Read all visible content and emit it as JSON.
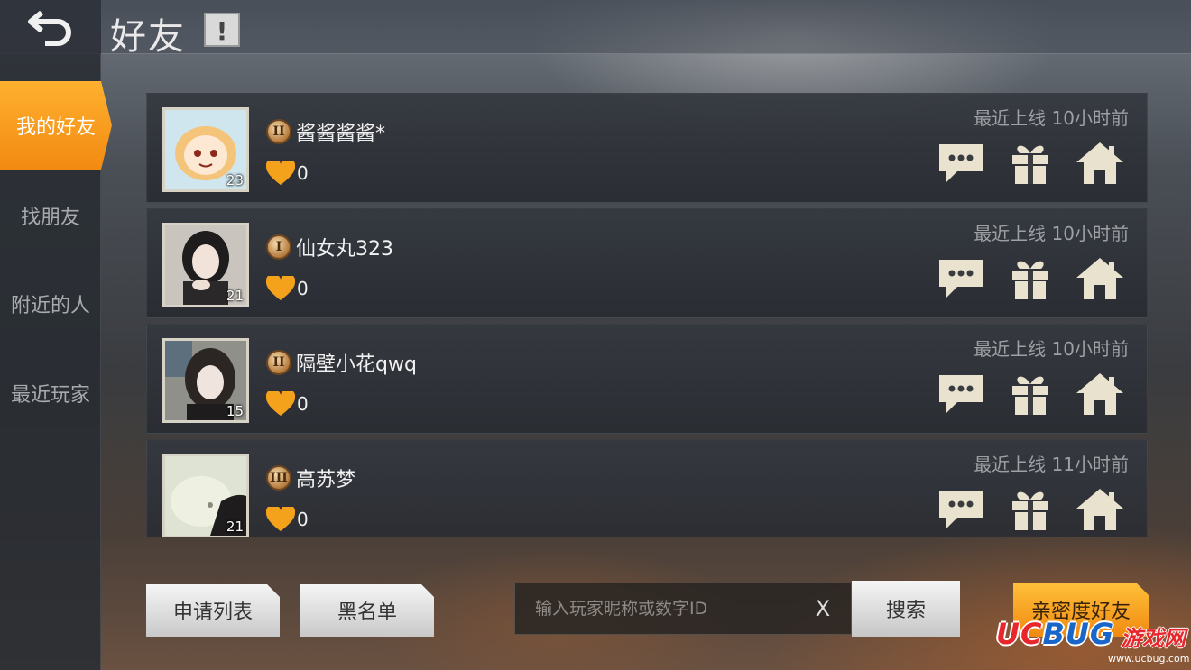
{
  "header": {
    "title": "好友",
    "info_label": "!"
  },
  "sidebar": {
    "items": [
      {
        "label": "我的好友",
        "active": true
      },
      {
        "label": "找朋友",
        "active": false
      },
      {
        "label": "附近的人",
        "active": false
      },
      {
        "label": "最近玩家",
        "active": false
      }
    ]
  },
  "friends": [
    {
      "name": "酱酱酱酱*",
      "rank": "II",
      "level": "23",
      "intimacy": "0",
      "last_online_label": "最近上线",
      "last_online": "10小时前"
    },
    {
      "name": "仙女丸323",
      "rank": "I",
      "level": "21",
      "intimacy": "0",
      "last_online_label": "最近上线",
      "last_online": "10小时前"
    },
    {
      "name": "隔壁小花qwq",
      "rank": "II",
      "level": "15",
      "intimacy": "0",
      "last_online_label": "最近上线",
      "last_online": "10小时前"
    },
    {
      "name": "高苏梦",
      "rank": "III",
      "level": "21",
      "intimacy": "0",
      "last_online_label": "最近上线",
      "last_online": "11小时前"
    }
  ],
  "bottom": {
    "apply_list": "申请列表",
    "blacklist": "黑名单",
    "search_placeholder": "输入玩家昵称或数字ID",
    "clear": "X",
    "search": "搜索",
    "intimate_friends": "亲密度好友"
  },
  "watermark": {
    "logo_u": "UC",
    "logo_b": "BUG",
    "logo_cn": "游戏网",
    "url": "www.ucbug.com"
  },
  "colors": {
    "accent_orange": "#f59a1a",
    "heart": "#f4a21c",
    "panel": "#34383f"
  },
  "icons": [
    "back-arrow-icon",
    "info-icon",
    "rank-badge-icon",
    "heart-icon",
    "chat-icon",
    "gift-icon",
    "home-icon"
  ]
}
